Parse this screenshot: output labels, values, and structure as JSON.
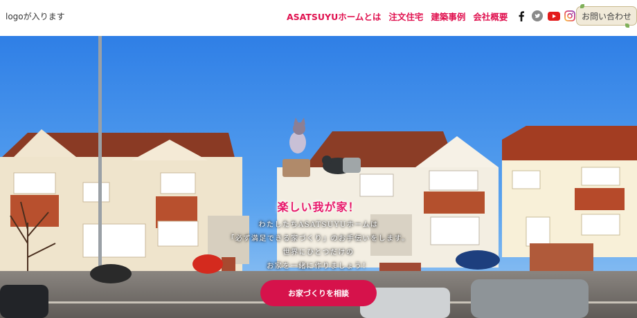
{
  "header": {
    "logo_text": "logoが入ります",
    "nav": [
      {
        "label": "ASATSUYUホームとは"
      },
      {
        "label": "注文住宅"
      },
      {
        "label": "建築事例"
      },
      {
        "label": "会社概要"
      }
    ],
    "social": [
      {
        "icon": "facebook-icon"
      },
      {
        "icon": "twitter-icon"
      },
      {
        "icon": "youtube-icon"
      },
      {
        "icon": "instagram-icon"
      }
    ],
    "contact_label": "お問い合わせ"
  },
  "hero": {
    "title": "楽しい我が家！",
    "lines": [
      "わたしたちASATSUYUホームは",
      "「必ず満足できる家づくり」のお手伝いをします。",
      "世界にひとつだけの",
      "お家を一緒に作りましょう！"
    ],
    "cta_label": "お家づくりを相談"
  },
  "colors": {
    "accent": "#e0114f",
    "cta": "#d6124b",
    "sky": "#3f8fe8"
  }
}
